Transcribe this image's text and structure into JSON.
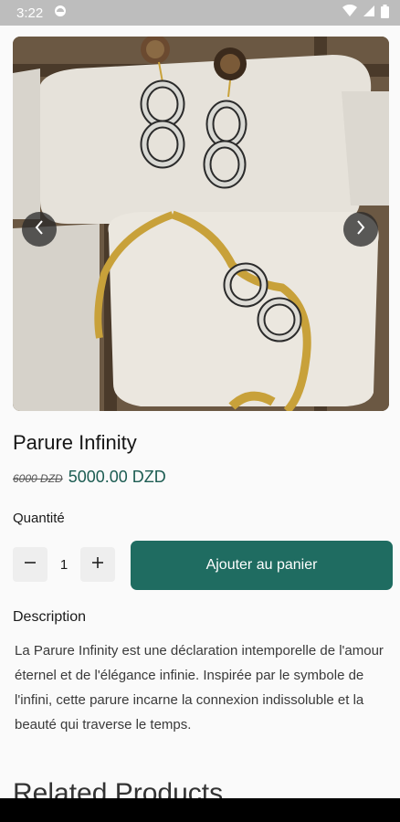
{
  "status_bar": {
    "time": "3:22",
    "icons": [
      "circle-icon",
      "wifi-icon",
      "signal-icon",
      "battery-icon"
    ]
  },
  "product": {
    "image_icon": "earrings-bracelet-photo",
    "title": "Parure Infinity",
    "old_price": "6000 DZD",
    "price": "5000.00 DZD"
  },
  "quantity": {
    "label": "Quantité",
    "value": "1",
    "decrement_icon": "minus-icon",
    "increment_icon": "plus-icon"
  },
  "actions": {
    "add_to_cart": "Ajouter au panier"
  },
  "description": {
    "title": "Description",
    "text": "La Parure Infinity est une déclaration intemporelle de l'amour éternel et de l'élégance infinie. Inspirée par le symbole de l'infini, cette parure incarne la connexion indissoluble et la beauté qui traverse le temps."
  },
  "related": {
    "title": "Related Products"
  },
  "colors": {
    "accent": "#1f6c61",
    "price": "#1c5c52",
    "status_bar": "#bdbdbd"
  }
}
